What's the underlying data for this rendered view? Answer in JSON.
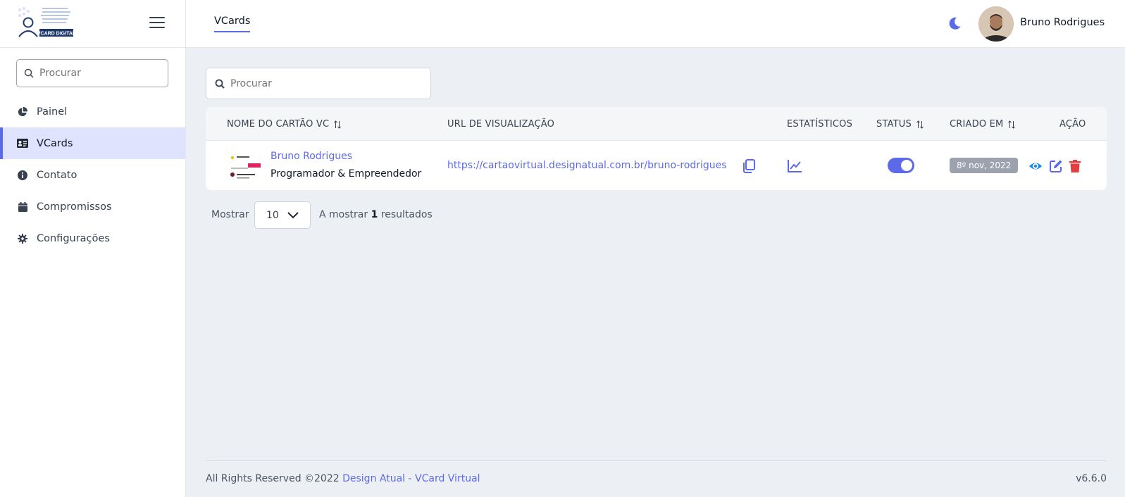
{
  "sidebar": {
    "logo_text": "VCARD DIGITAL",
    "search_placeholder": "Procurar",
    "items": [
      {
        "label": "Painel",
        "icon": "pie-chart-icon"
      },
      {
        "label": "VCards",
        "icon": "id-card-icon",
        "active": true
      },
      {
        "label": "Contato",
        "icon": "info-icon"
      },
      {
        "label": "Compromissos",
        "icon": "calendar-icon"
      },
      {
        "label": "Configurações",
        "icon": "gear-icon"
      }
    ]
  },
  "header": {
    "tab": "VCards",
    "user_name": "Bruno Rodrigues"
  },
  "main": {
    "search_placeholder": "Procurar",
    "table": {
      "columns": {
        "name": "NOME DO CARTÃO VC",
        "url": "URL DE VISUALIZAÇÃO",
        "stats": "ESTATÍSTICOS",
        "status": "STATUS",
        "created": "CRIADO EM",
        "action": "AÇÃO"
      },
      "rows": [
        {
          "name": "Bruno Rodrigues",
          "role": "Programador & Empreendedor",
          "url": "https://cartaovirtual.designatual.com.br/bruno-rodrigues",
          "status_on": true,
          "created": "8º nov, 2022"
        }
      ]
    },
    "pagination": {
      "show_label": "Mostrar",
      "per_page": "10",
      "results_prefix": "A mostrar",
      "results_count": "1",
      "results_suffix": "resultados"
    }
  },
  "footer": {
    "rights": "All Rights Reserved ©2022",
    "link": "Design Atual - VCard Virtual",
    "version": "v6.6.0"
  },
  "colors": {
    "accent": "#5d6ae8",
    "active_bg": "#dfe3fd",
    "delete": "#e53e3e",
    "badge": "#9ca3af"
  }
}
